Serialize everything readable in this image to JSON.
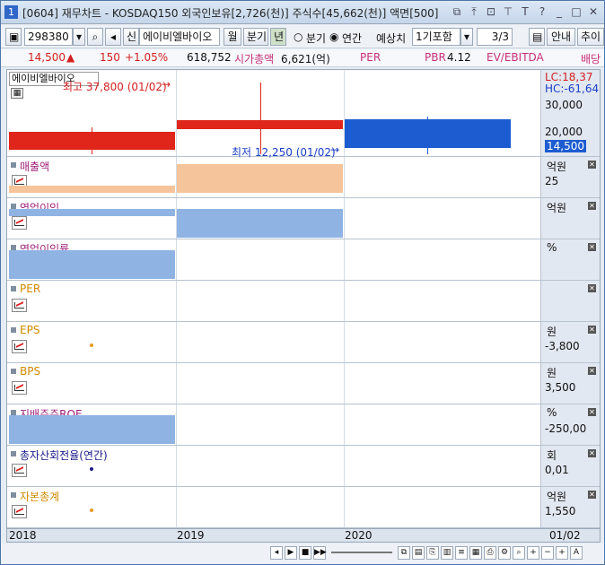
{
  "window": {
    "number": "1",
    "title": "[0604] 재무차트 - KOSDAQ150 외국인보유[2,726(천)] 주식수[45,662(천)] 액면[500]",
    "title_icons": [
      "window-icon",
      "pin-icon",
      "link-icon",
      "toolbar-icon",
      "text-icon",
      "help-icon",
      "minimize-icon",
      "maximize-icon",
      "close-icon"
    ]
  },
  "toolbar": {
    "stock_code": "298380",
    "new_badge": "신",
    "stock_name": "에이비엘바이오",
    "btn_month": "월",
    "btn_quarter": "분기",
    "btn_year": "년",
    "radio_quarter": "분기",
    "radio_annual": "연간",
    "estimate_label": "예상치",
    "estimate_select": "1기포함",
    "page": "3/3",
    "guide": "안내",
    "add": "추이"
  },
  "info": {
    "price": "14,500",
    "change": "150",
    "change_pct": "+1.05%",
    "volume": "618,752",
    "mcap_label": "시가총액",
    "mcap_value": "6,621(억)",
    "per_label": "PER",
    "pbr_label": "PBR",
    "pbr_value": "4.12",
    "ev_label": "EV/EBITDA",
    "div_label": "배당"
  },
  "main_panel": {
    "stock_label": "에이비엘바이오",
    "high_label": "최고 37,800 (01/02)",
    "low_label": "최저 12,250 (01/02)",
    "lc": "LC:18,37",
    "hc": "HC:-61,64",
    "axis": [
      "30,000",
      "20,000"
    ],
    "current": "14,500"
  },
  "panels": [
    {
      "title": "매출액",
      "unit": "억원",
      "axis_val": "25",
      "title_color": "#a0207a"
    },
    {
      "title": "영업이익",
      "unit": "억원",
      "axis_val": "",
      "title_color": "#a0207a"
    },
    {
      "title": "영업이익률",
      "unit": "%",
      "axis_val": "",
      "title_color": "#a0207a"
    },
    {
      "title": "PER",
      "unit": "",
      "axis_val": "",
      "title_color": "#d08a00"
    },
    {
      "title": "EPS",
      "unit": "원",
      "axis_val": "-3,800",
      "title_color": "#d08a00"
    },
    {
      "title": "BPS",
      "unit": "원",
      "axis_val": "3,500",
      "title_color": "#d08a00"
    },
    {
      "title": "지배주주ROE",
      "unit": "%",
      "axis_val": "-250,00",
      "title_color": "#a0207a"
    },
    {
      "title": "총자산회전율(연간)",
      "unit": "회",
      "axis_val": "0,01",
      "title_color": "#1a1a8a"
    },
    {
      "title": "자본총계",
      "unit": "억원",
      "axis_val": "1,550",
      "title_color": "#d08a00"
    }
  ],
  "xaxis": {
    "labels": [
      "2018",
      "2019",
      "2020"
    ],
    "right": "01/02"
  },
  "colors": {
    "up": "#e0251b",
    "down": "#1c5cd0",
    "sales": "#f6c49a",
    "op": "#8fb4e3"
  }
}
